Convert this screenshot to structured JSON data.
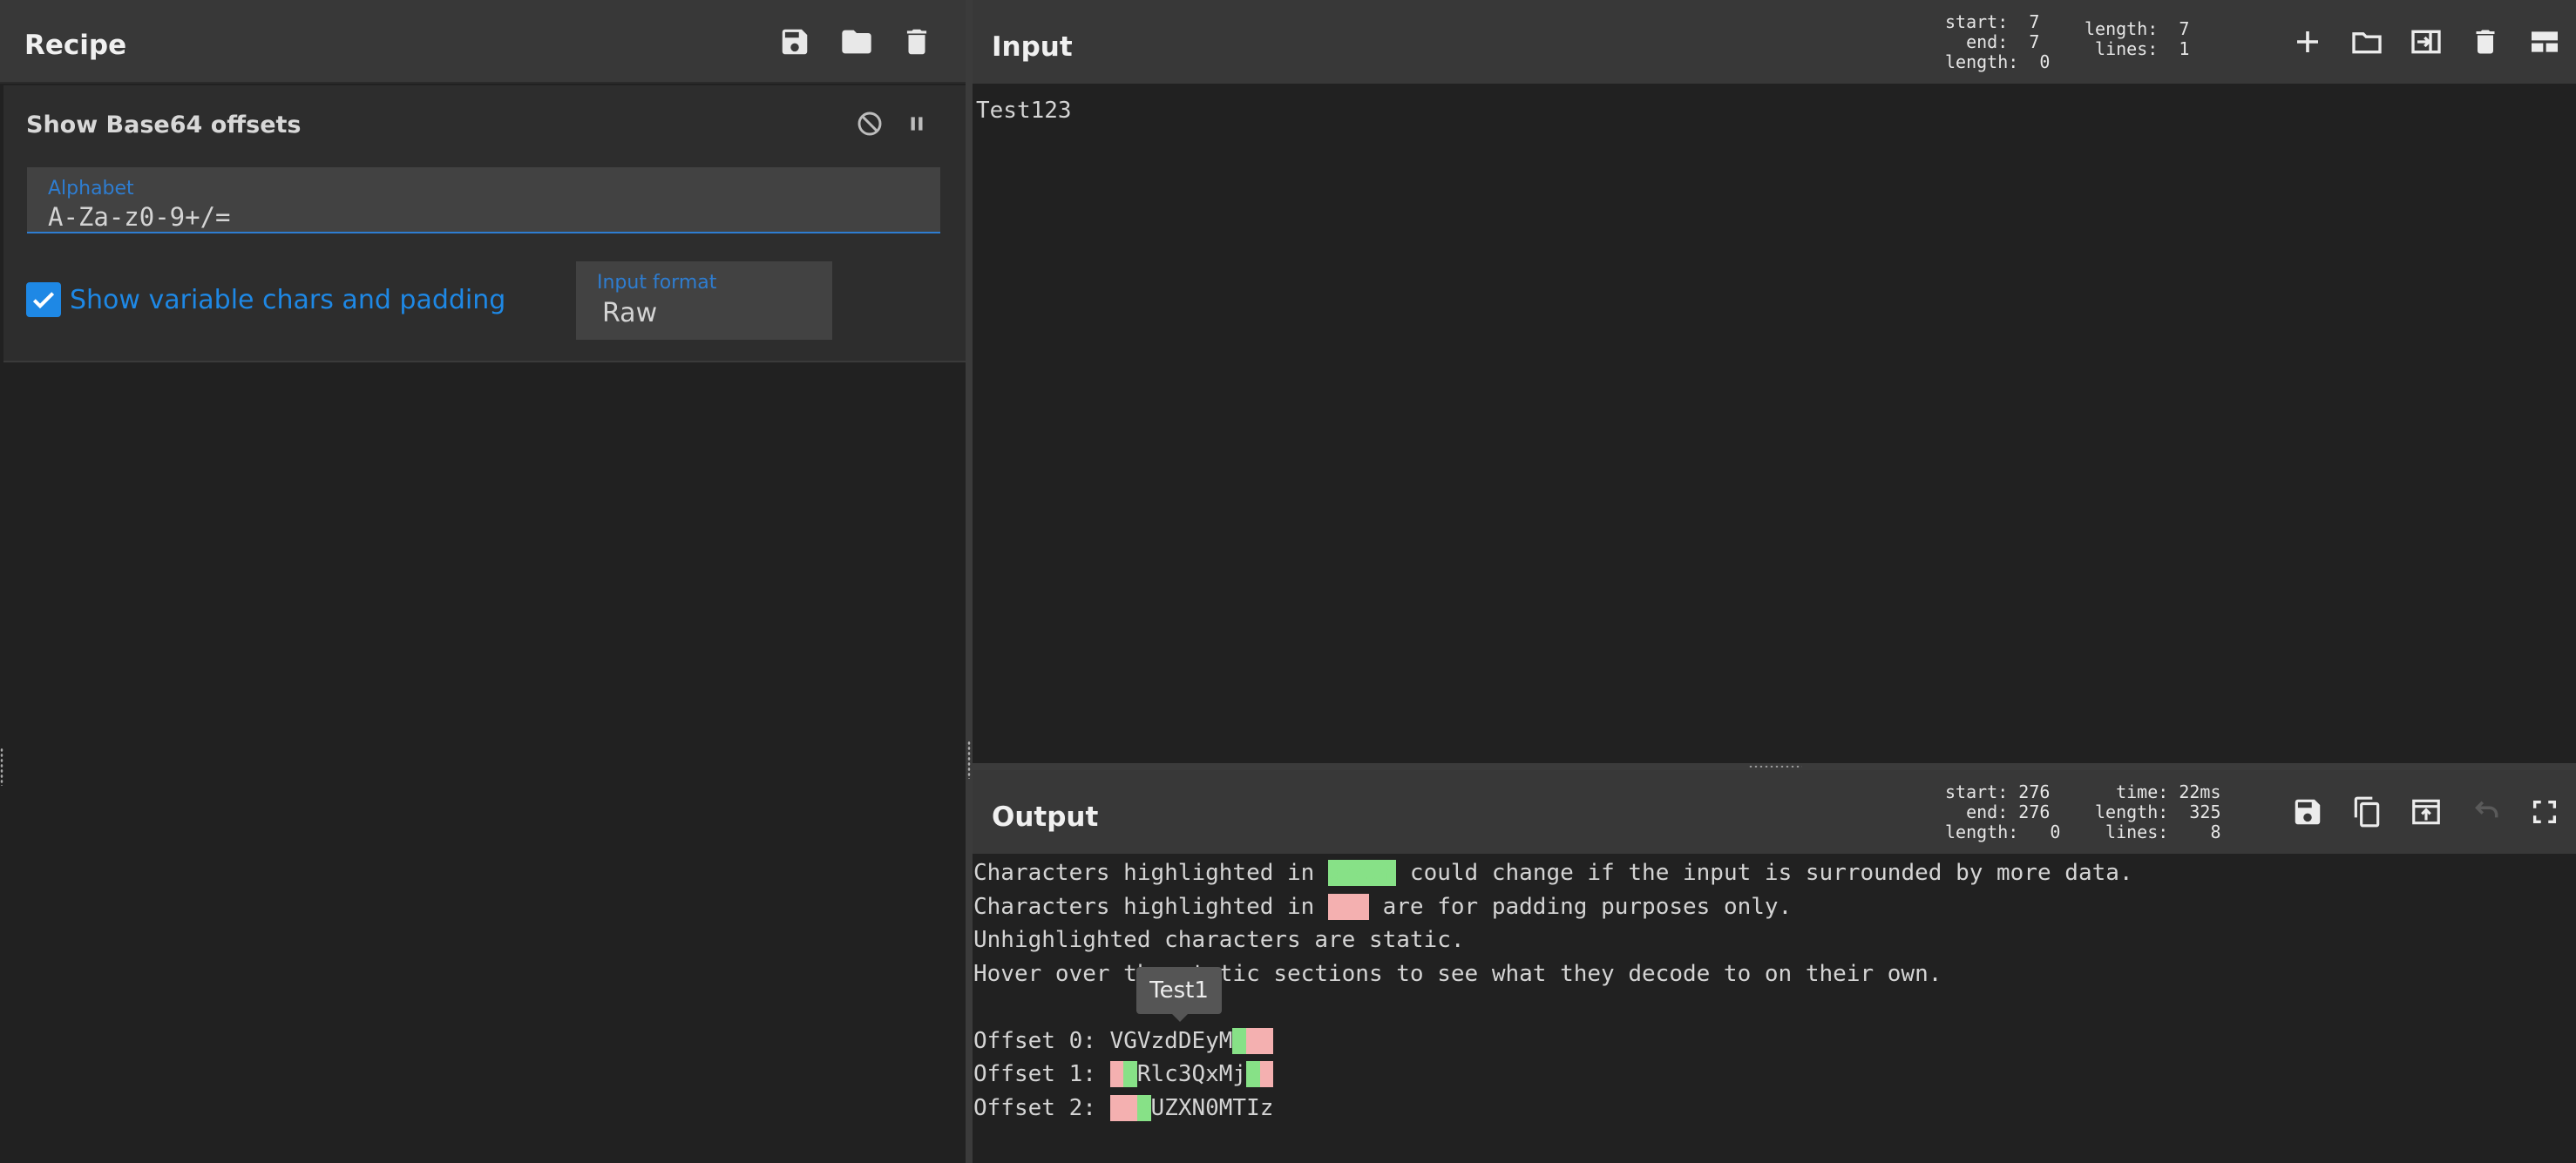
{
  "recipe": {
    "title": "Recipe",
    "icons": [
      "save-icon",
      "folder-icon",
      "trash-icon"
    ],
    "operation": {
      "name": "Show Base64 offsets",
      "icons": [
        "disable-icon",
        "pause-icon"
      ],
      "alphabet_label": "Alphabet",
      "alphabet_value": "A-Za-z0-9+/=",
      "checkbox_label": "Show variable chars and padding",
      "checkbox_checked": true,
      "input_format_label": "Input format",
      "input_format_value": "Raw"
    }
  },
  "input": {
    "title": "Input",
    "stats_left": "start:  7\n  end:  7\nlength:  0",
    "stats_right": "length:  7\n lines:  1",
    "text": "Test123",
    "icons": [
      "plus-icon",
      "folder-icon",
      "import-icon",
      "trash-icon",
      "layout-icon"
    ]
  },
  "output": {
    "title": "Output",
    "stats_left": "start: 276\n  end: 276\nlength:   0",
    "stats_right": "  time: 22ms\nlength:  325\n lines:    8",
    "icons": [
      "save-icon",
      "copy-icon",
      "replace-input-icon",
      "undo-icon",
      "maximize-icon"
    ],
    "lines": {
      "l1_pre": "Characters highlighted in ",
      "l1_hl": "green",
      "l1_post": " could change if the input is surrounded by more data.",
      "l2_pre": "Characters highlighted in ",
      "l2_hl": "red",
      "l2_post": " are for padding purposes only.",
      "l3": "Unhighlighted characters are static.",
      "l4": "Hover over the static sections to see what they decode to on their own.",
      "o0_label": "Offset 0: ",
      "o0_static": "VGVzdDEyM",
      "o0_green": "z",
      "o0_red": "==",
      "o1_label": "Offset 1: ",
      "o1_red": "V",
      "o1_green": "G",
      "o1_static": "Rlc3QxMj",
      "o1_green2": "M",
      "o1_red2": "=",
      "o2_label": "Offset 2: ",
      "o2_red": "VG",
      "o2_green": "V",
      "o2_static": "UZXN0MTIz"
    },
    "tooltip": "Test1"
  },
  "colors": {
    "accent": "#1e88e5",
    "highlight_green": "#87e187",
    "highlight_red": "#f4b0b0"
  }
}
